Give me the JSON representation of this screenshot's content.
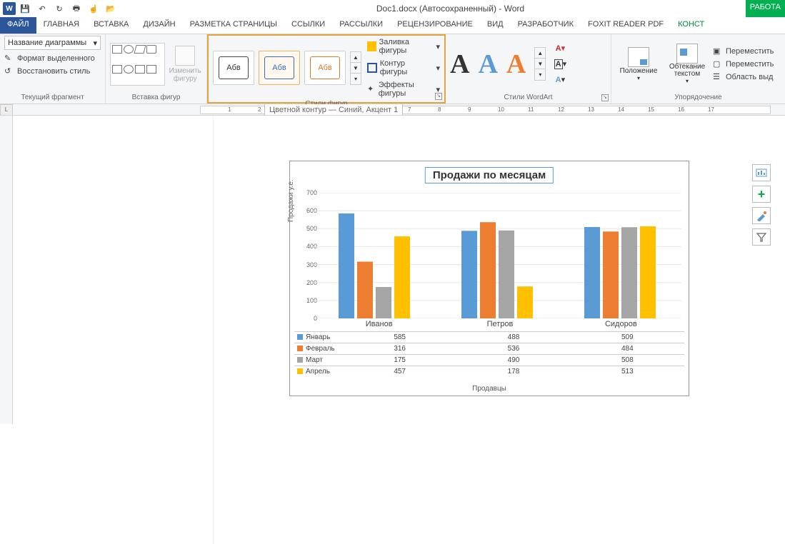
{
  "title": "Doc1.docx (Автосохраненный) - Word",
  "contextual_tab": "РАБОТА",
  "tabs": [
    "ФАЙЛ",
    "ГЛАВНАЯ",
    "ВСТАВКА",
    "ДИЗАЙН",
    "РАЗМЕТКА СТРАНИЦЫ",
    "ССЫЛКИ",
    "РАССЫЛКИ",
    "РЕЦЕНЗИРОВАНИЕ",
    "ВИД",
    "РАЗРАБОТЧИК",
    "FOXIT READER PDF",
    "КОНСТ"
  ],
  "ribbon": {
    "chart_elem": {
      "dropdown": "Название диаграммы",
      "format_sel": "Формат выделенного",
      "reset": "Восстановить стиль",
      "label": "Текущий фрагмент"
    },
    "shapes": {
      "change": "Изменить фигуру",
      "label": "Вставка фигур"
    },
    "styles": {
      "thumb_text": "Абв",
      "fill": "Заливка фигуры",
      "outline": "Контур фигуры",
      "effects": "Эффекты фигуры",
      "label": "Стили фигур",
      "tooltip": "Цветной контур — Синий, Акцент 1"
    },
    "wordart": {
      "label": "Стили WordArt"
    },
    "arrange": {
      "position": "Положение",
      "wrap": "Обтекание текстом",
      "forward": "Переместить",
      "backward": "Переместить",
      "selpane": "Область выд",
      "label": "Упорядочение"
    }
  },
  "chart_data": {
    "type": "bar",
    "title": "Продажи по месяцам",
    "ylabel": "Продажи у.е.",
    "xlabel": "Продавцы",
    "categories": [
      "Иванов",
      "Петров",
      "Сидоров"
    ],
    "series": [
      {
        "name": "Январь",
        "color": "#5b9bd5",
        "values": [
          585,
          488,
          509
        ]
      },
      {
        "name": "Февраль",
        "color": "#ed7d31",
        "values": [
          316,
          536,
          484
        ]
      },
      {
        "name": "Март",
        "color": "#a5a5a5",
        "values": [
          175,
          490,
          508
        ]
      },
      {
        "name": "Апрель",
        "color": "#ffc000",
        "values": [
          457,
          178,
          513
        ]
      }
    ],
    "ylim": [
      0,
      700
    ],
    "yticks": [
      0,
      100,
      200,
      300,
      400,
      500,
      600,
      700
    ]
  }
}
